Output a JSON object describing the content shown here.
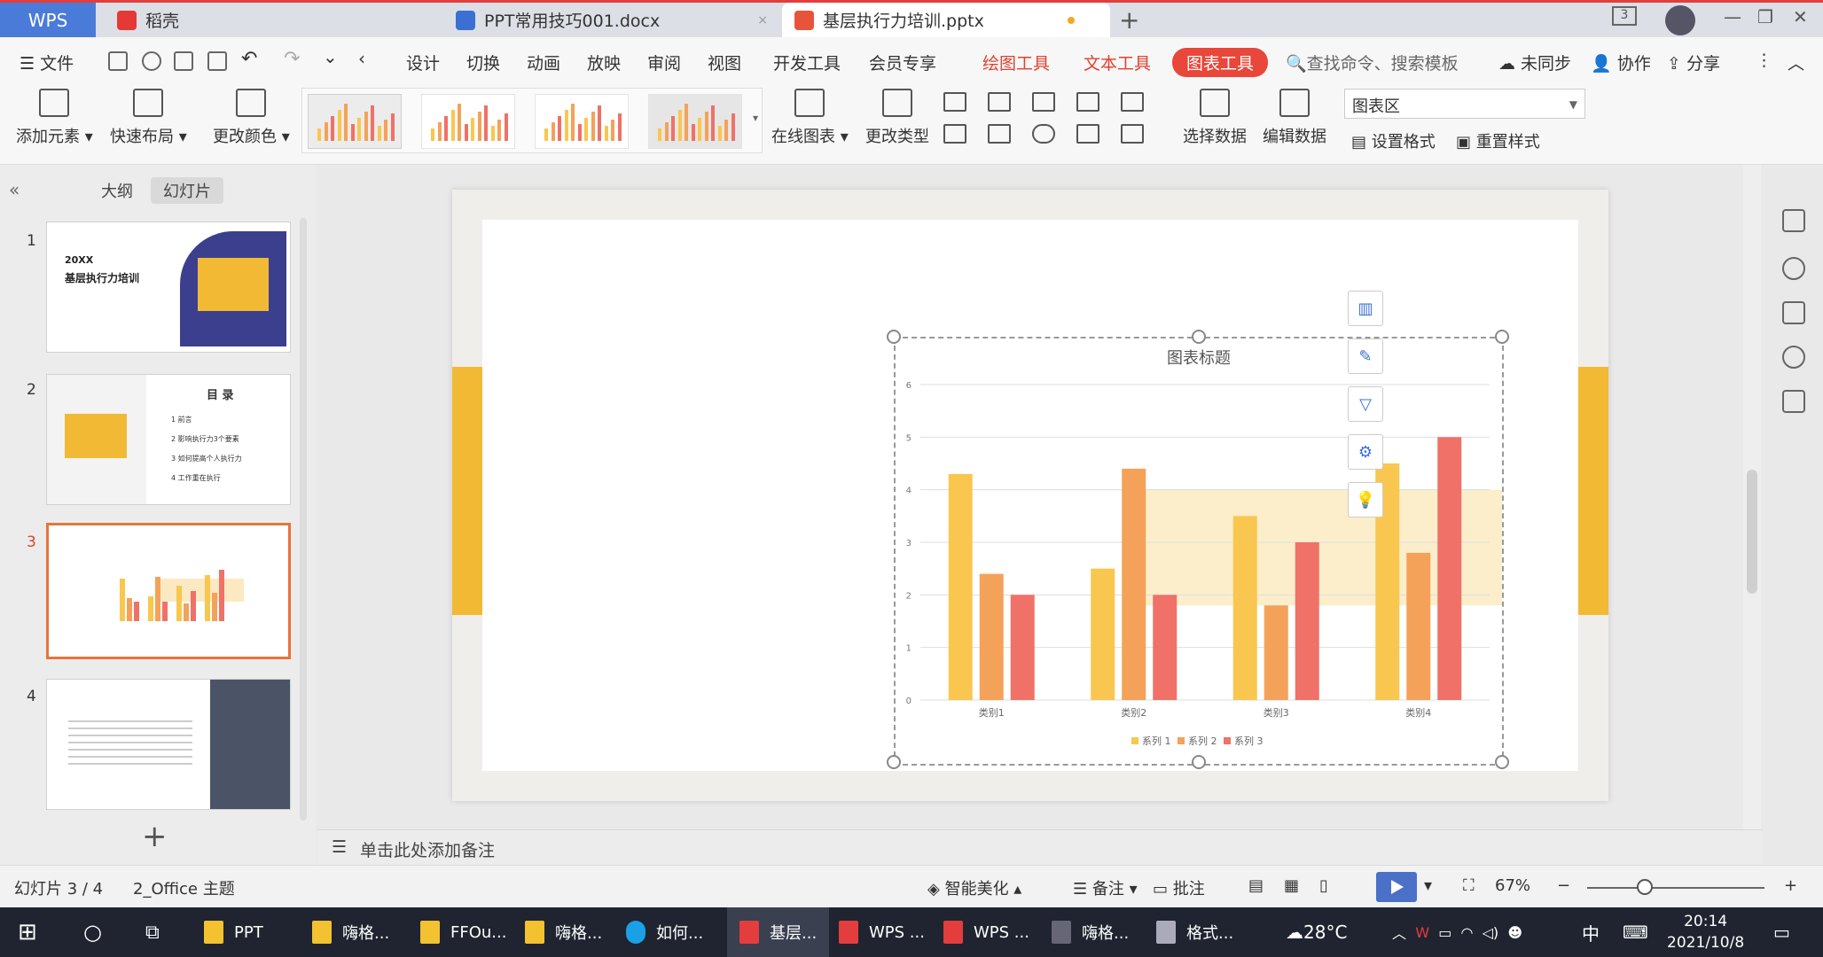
{
  "titlebar": {
    "wps_label": "WPS",
    "tabs": [
      {
        "label": "稻壳"
      },
      {
        "label": "PPT常用技巧001.docx"
      },
      {
        "label": "基层执行力培训.pptx"
      }
    ],
    "new_tab": "+"
  },
  "menu": {
    "file": "文件",
    "items": [
      "设计",
      "切换",
      "动画",
      "放映",
      "审阅",
      "视图",
      "开发工具",
      "会员专享"
    ],
    "draw_tools": "绘图工具",
    "text_tools": "文本工具",
    "chart_tools": "图表工具",
    "search": "查找命令、搜索模板",
    "sync": "未同步",
    "collab": "协作",
    "share": "分享"
  },
  "ribbon": {
    "add_element": "添加元素",
    "quick_layout": "快速布局",
    "change_color": "更改颜色",
    "online_chart": "在线图表",
    "change_type": "更改类型",
    "select_data": "选择数据",
    "edit_data": "编辑数据",
    "area_select": "图表区",
    "format": "设置格式",
    "reset_style": "重置样式"
  },
  "left_panel": {
    "tab_outline": "大纲",
    "tab_slides": "幻灯片",
    "slides": [
      {
        "num": "1",
        "title1": "20XX",
        "title2": "基层执行力培训"
      },
      {
        "num": "2",
        "title": "目 录",
        "items": [
          "1  前言",
          "2  影响执行力3个要素",
          "3  如何提高个人执行力",
          "4  工作重在执行"
        ]
      },
      {
        "num": "3"
      },
      {
        "num": "4"
      }
    ],
    "add": "+"
  },
  "chart_data": {
    "type": "bar",
    "title": "图表标题",
    "categories": [
      "类别1",
      "类别2",
      "类别3",
      "类别4"
    ],
    "series": [
      {
        "name": "系列 1",
        "values": [
          4.3,
          2.5,
          3.5,
          4.5
        ],
        "color": "#f9c74f"
      },
      {
        "name": "系列 2",
        "values": [
          2.4,
          4.4,
          1.8,
          2.8
        ],
        "color": "#f4a259"
      },
      {
        "name": "系列 3",
        "values": [
          2.0,
          2.0,
          3.0,
          5.0
        ],
        "color": "#f07167"
      }
    ],
    "ylim": [
      0,
      6
    ],
    "yticks": [
      "0",
      "1",
      "2",
      "3",
      "4",
      "5",
      "6"
    ],
    "grid": true,
    "legend": "bottom"
  },
  "notes": {
    "placeholder": "单击此处添加备注"
  },
  "status": {
    "slide_info": "幻灯片 3 / 4",
    "theme": "2_Office 主题",
    "beautify": "智能美化",
    "notes": "备注",
    "comment": "批注",
    "zoom": "67%"
  },
  "taskbar": {
    "items": [
      "PPT",
      "嗨格...",
      "FFOu...",
      "嗨格...",
      "如何...",
      "基层...",
      "WPS ...",
      "WPS ...",
      "嗨格...",
      "格式..."
    ],
    "temp": "28°C",
    "ime": "中",
    "time": "20:14",
    "date": "2021/10/8"
  }
}
